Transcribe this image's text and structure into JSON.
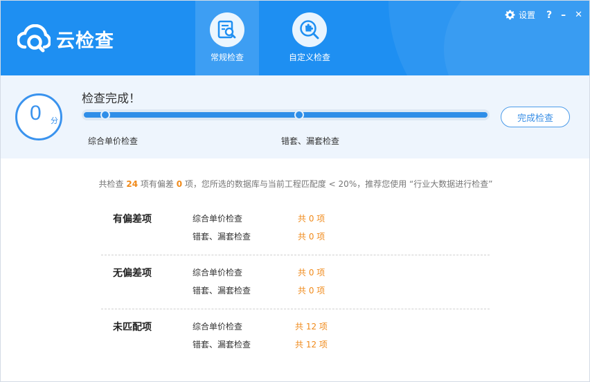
{
  "app": {
    "title": "云检查"
  },
  "tabs": [
    {
      "label": "常规检查",
      "icon": "document-search-icon",
      "active": true
    },
    {
      "label": "自定义检查",
      "icon": "puzzle-search-icon",
      "active": false
    }
  ],
  "top_controls": {
    "settings_label": "设置",
    "help_label": "?",
    "minimize_label": "–",
    "close_label": "✕"
  },
  "status": {
    "score": "0",
    "score_unit": "分",
    "title": "检查完成！",
    "progress": 1.0,
    "steps": [
      "综合单价检查",
      "错套、漏套检查"
    ],
    "finish_button": "完成检查"
  },
  "summary": {
    "prefix": "共检查 ",
    "total": "24",
    "mid1": " 项有偏差 ",
    "deviation": "0",
    "suffix": " 项，您所选的数据库与当前工程匹配度 < 20%，推荐您使用 “行业大数据进行检查”"
  },
  "groups": [
    {
      "title": "有偏差项",
      "rows": [
        {
          "label": "综合单价检查",
          "count": "共 0 项"
        },
        {
          "label": "错套、漏套检查",
          "count": "共 0 项"
        }
      ]
    },
    {
      "title": "无偏差项",
      "rows": [
        {
          "label": "综合单价检查",
          "count": "共 0 项"
        },
        {
          "label": "错套、漏套检查",
          "count": "共 0 项"
        }
      ]
    },
    {
      "title": "未匹配项",
      "rows": [
        {
          "label": "综合单价检查",
          "count": "共 12 项"
        },
        {
          "label": "错套、漏套检查",
          "count": "共 12 项"
        }
      ]
    }
  ],
  "colors": {
    "brand": "#1e8ff2",
    "accent": "#2f8ee8",
    "highlight": "#f08a1a"
  }
}
